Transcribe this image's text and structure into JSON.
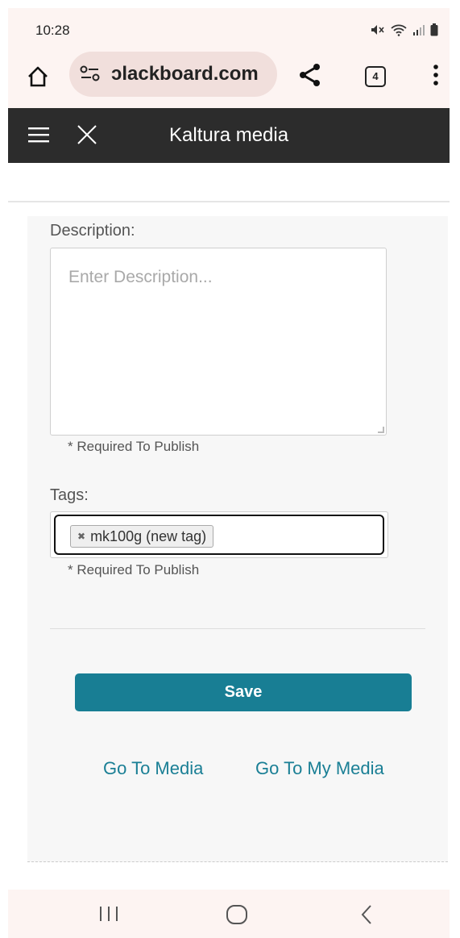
{
  "status_bar": {
    "time": "10:28",
    "icons": [
      "mute-icon",
      "wifi-icon",
      "signal-icon",
      "battery-icon"
    ]
  },
  "browser": {
    "url": "ɔlackboard.com",
    "tab_count": "4",
    "icons": [
      "home-icon",
      "site-settings-icon",
      "share-icon",
      "tabs-icon",
      "more-vert-icon"
    ]
  },
  "app_header": {
    "title": "Kaltura media",
    "icons": [
      "hamburger-icon",
      "close-icon"
    ]
  },
  "form": {
    "description_label": "Description:",
    "description_placeholder": "Enter Description...",
    "description_value": "",
    "description_required_note": "* Required To Publish",
    "tags_label": "Tags:",
    "tags": [
      {
        "label": "mk100g (new tag)"
      }
    ],
    "tags_required_note": "* Required To Publish",
    "save_label": "Save",
    "link_media": "Go To Media",
    "link_my_media": "Go To My Media"
  },
  "nav_bar": {
    "icons": [
      "recent-apps-icon",
      "home-circle-icon",
      "back-icon"
    ]
  },
  "colors": {
    "save_button": "#187e94",
    "link": "#1a7f95",
    "header_bg": "#2c2c2c",
    "system_bar_bg": "#fdf4f2"
  }
}
